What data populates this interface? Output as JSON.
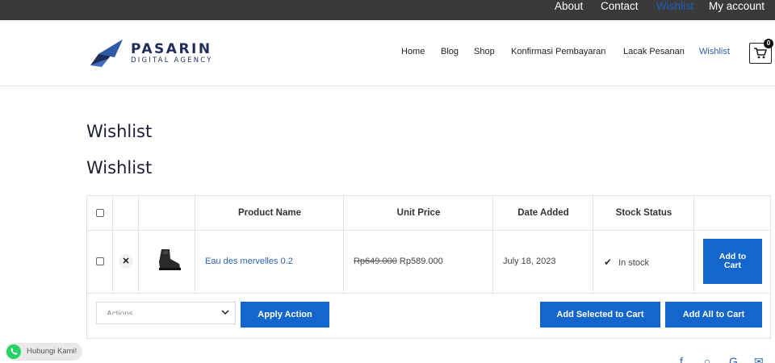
{
  "topbar": {
    "links": [
      "About",
      "Contact",
      "Wishlist",
      "My account"
    ]
  },
  "logo": {
    "name": "PASARIN",
    "tagline": "DIGITAL AGENCY"
  },
  "nav": {
    "items": [
      "Home",
      "Blog",
      "Shop",
      "Konfirmasi Pembayaran",
      "Lacak Pesanan",
      "Wishlist"
    ],
    "active": "Wishlist",
    "cart_count": "0"
  },
  "page": {
    "title": "Wishlist",
    "wishlist_title": "Wishlist"
  },
  "table": {
    "headers": [
      "Product Name",
      "Unit Price",
      "Date Added",
      "Stock Status"
    ],
    "rows": [
      {
        "product_name": "Eau des mervelles 0.2",
        "old_price": "Rp649.000",
        "price": "Rp589.000",
        "date_added": "July 18, 2023",
        "stock_status": "In stock",
        "add_to_cart": "Add to Cart"
      }
    ]
  },
  "actions": {
    "select_value": "Actions",
    "apply_label": "Apply Action",
    "add_selected_label": "Add Selected to Cart",
    "add_all_label": "Add All to Cart"
  },
  "whatsapp": {
    "label": "Hubungi Kami!"
  },
  "colors": {
    "accent": "#1466cc",
    "topbar": "#3a3a3a",
    "link": "#2b63b5"
  }
}
